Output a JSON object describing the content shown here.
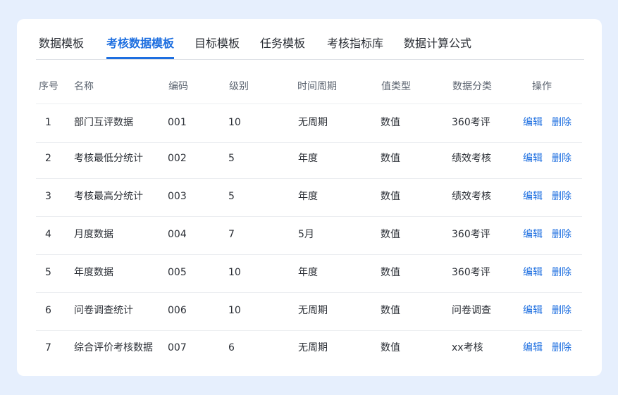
{
  "tabs": [
    {
      "label": "数据模板",
      "active": false
    },
    {
      "label": "考核数据模板",
      "active": true
    },
    {
      "label": "目标模板",
      "active": false
    },
    {
      "label": "任务模板",
      "active": false
    },
    {
      "label": "考核指标库",
      "active": false
    },
    {
      "label": "数据计算公式",
      "active": false
    }
  ],
  "table": {
    "headers": [
      "序号",
      "名称",
      "编码",
      "级别",
      "时间周期",
      "值类型",
      "数据分类",
      "操作"
    ],
    "edit_label": "编辑",
    "delete_label": "删除",
    "rows": [
      [
        "1",
        "部门互评数据",
        "001",
        "10",
        "无周期",
        "数值",
        "360考评"
      ],
      [
        "2",
        "考核最低分统计",
        "002",
        "5",
        "年度",
        "数值",
        "绩效考核"
      ],
      [
        "3",
        "考核最高分统计",
        "003",
        "5",
        "年度",
        "数值",
        "绩效考核"
      ],
      [
        "4",
        "月度数据",
        "004",
        "7",
        "5月",
        "数值",
        "360考评"
      ],
      [
        "5",
        "年度数据",
        "005",
        "10",
        "年度",
        "数值",
        "360考评"
      ],
      [
        "6",
        "问卷调查统计",
        "006",
        "10",
        "无周期",
        "数值",
        "问卷调查"
      ],
      [
        "7",
        "综合评价考核数据",
        "007",
        "6",
        "无周期",
        "数值",
        "xx考核"
      ]
    ]
  },
  "colors": {
    "accent": "#1e6fe0",
    "page_bg": "#e6effd"
  }
}
